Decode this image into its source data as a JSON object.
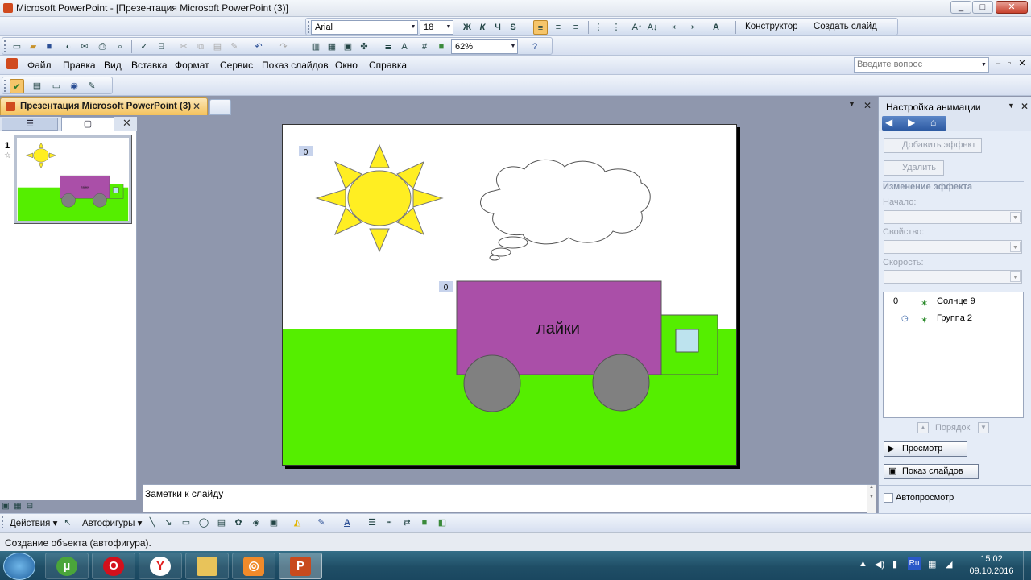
{
  "window": {
    "title": "Microsoft PowerPoint - [Презентация Microsoft PowerPoint (3)]",
    "buttons": [
      "_",
      "□",
      "✕"
    ]
  },
  "format_toolbar": {
    "font": "Arial",
    "size": "18",
    "bold": "Ж",
    "italic": "К",
    "underline": "Ч",
    "shadow": "S",
    "designer": "Конструктор",
    "new_slide": "Создать слайд"
  },
  "standard_toolbar": {
    "zoom": "62%"
  },
  "menu": {
    "items": [
      "Файл",
      "Правка",
      "Вид",
      "Вставка",
      "Формат",
      "Сервис",
      "Показ слайдов",
      "Окно",
      "Справка"
    ],
    "ask_placeholder": "Введите вопрос"
  },
  "doc": {
    "tab_title": "Презентация Microsoft PowerPoint (3)"
  },
  "slides_panel": {
    "slide_number": "1",
    "truck_label_small": "лайки"
  },
  "slide": {
    "anim_tag_sun": "0",
    "anim_tag_truck": "0",
    "truck_label": "лайки",
    "colors": {
      "ground": "#55ee00",
      "sun": "#ffee22",
      "truck_body": "#aa4fa8",
      "wheels": "#808080",
      "cab": "#55ee00",
      "window": "#bde3ee"
    }
  },
  "notes": {
    "placeholder": "Заметки к слайду"
  },
  "anim_pane": {
    "title": "Настройка анимации",
    "add_effect": "Добавить эффект",
    "remove": "Удалить",
    "change_effect": "Изменение эффекта",
    "start_label": "Начало:",
    "property_label": "Свойство:",
    "speed_label": "Скорость:",
    "items": [
      {
        "num": "0",
        "name": "Солнце 9"
      },
      {
        "num": "",
        "name": "Группа 2"
      }
    ],
    "order": "Порядок",
    "preview": "Просмотр",
    "slideshow": "Показ слайдов",
    "autopreview": "Автопросмотр"
  },
  "draw_toolbar": {
    "actions": "Действия",
    "autoshapes": "Автофигуры"
  },
  "status": {
    "text": "Создание объекта (автофигура)."
  },
  "taskbar": {
    "lang": "Ru",
    "time": "15:02",
    "date": "09.10.2016"
  }
}
